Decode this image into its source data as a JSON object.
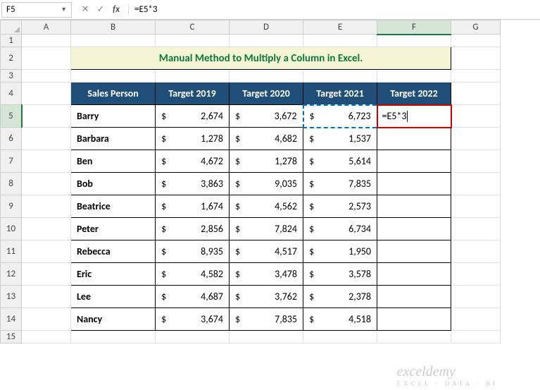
{
  "name_box": "F5",
  "formula_bar": "=E5*3",
  "columns": [
    "A",
    "B",
    "C",
    "D",
    "E",
    "F",
    "G"
  ],
  "title": "Manual Method to Multiply a Column in Excel.",
  "headers": {
    "b": "Sales Person",
    "c": "Target 2019",
    "d": "Target 2020",
    "e": "Target 2021",
    "f": "Target 2022"
  },
  "editing_cell": "=E5*3",
  "rows": [
    {
      "n": "Barry",
      "c": "2,674",
      "d": "3,672",
      "e": "6,723"
    },
    {
      "n": "Barbara",
      "c": "1,278",
      "d": "4,682",
      "e": "1,537"
    },
    {
      "n": "Ben",
      "c": "4,672",
      "d": "1,278",
      "e": "5,614"
    },
    {
      "n": "Bob",
      "c": "3,863",
      "d": "9,035",
      "e": "7,835"
    },
    {
      "n": "Beatrice",
      "c": "1,674",
      "d": "4,562",
      "e": "2,573"
    },
    {
      "n": "Peter",
      "c": "2,856",
      "d": "7,824",
      "e": "6,734"
    },
    {
      "n": "Rebecca",
      "c": "8,935",
      "d": "4,517",
      "e": "1,950"
    },
    {
      "n": "Eric",
      "c": "4,582",
      "d": "3,478",
      "e": "3,578"
    },
    {
      "n": "Lee",
      "c": "4,687",
      "d": "3,762",
      "e": "2,378"
    },
    {
      "n": "Nancy",
      "c": "3,674",
      "d": "7,835",
      "e": "4,518"
    }
  ],
  "watermark": {
    "main": "exceldemy",
    "sub": "EXCEL · DATA · BI"
  },
  "chart_data": {
    "type": "table",
    "title": "Manual Method to Multiply a Column in Excel.",
    "columns": [
      "Sales Person",
      "Target 2019",
      "Target 2020",
      "Target 2021",
      "Target 2022"
    ],
    "rows": [
      [
        "Barry",
        2674,
        3672,
        6723,
        null
      ],
      [
        "Barbara",
        1278,
        4682,
        1537,
        null
      ],
      [
        "Ben",
        4672,
        1278,
        5614,
        null
      ],
      [
        "Bob",
        3863,
        9035,
        7835,
        null
      ],
      [
        "Beatrice",
        1674,
        4562,
        2573,
        null
      ],
      [
        "Peter",
        2856,
        7824,
        6734,
        null
      ],
      [
        "Rebecca",
        8935,
        4517,
        1950,
        null
      ],
      [
        "Eric",
        4582,
        3478,
        3578,
        null
      ],
      [
        "Lee",
        4687,
        3762,
        2378,
        null
      ],
      [
        "Nancy",
        3674,
        7835,
        4518,
        null
      ]
    ],
    "active_formula": "=E5*3"
  }
}
